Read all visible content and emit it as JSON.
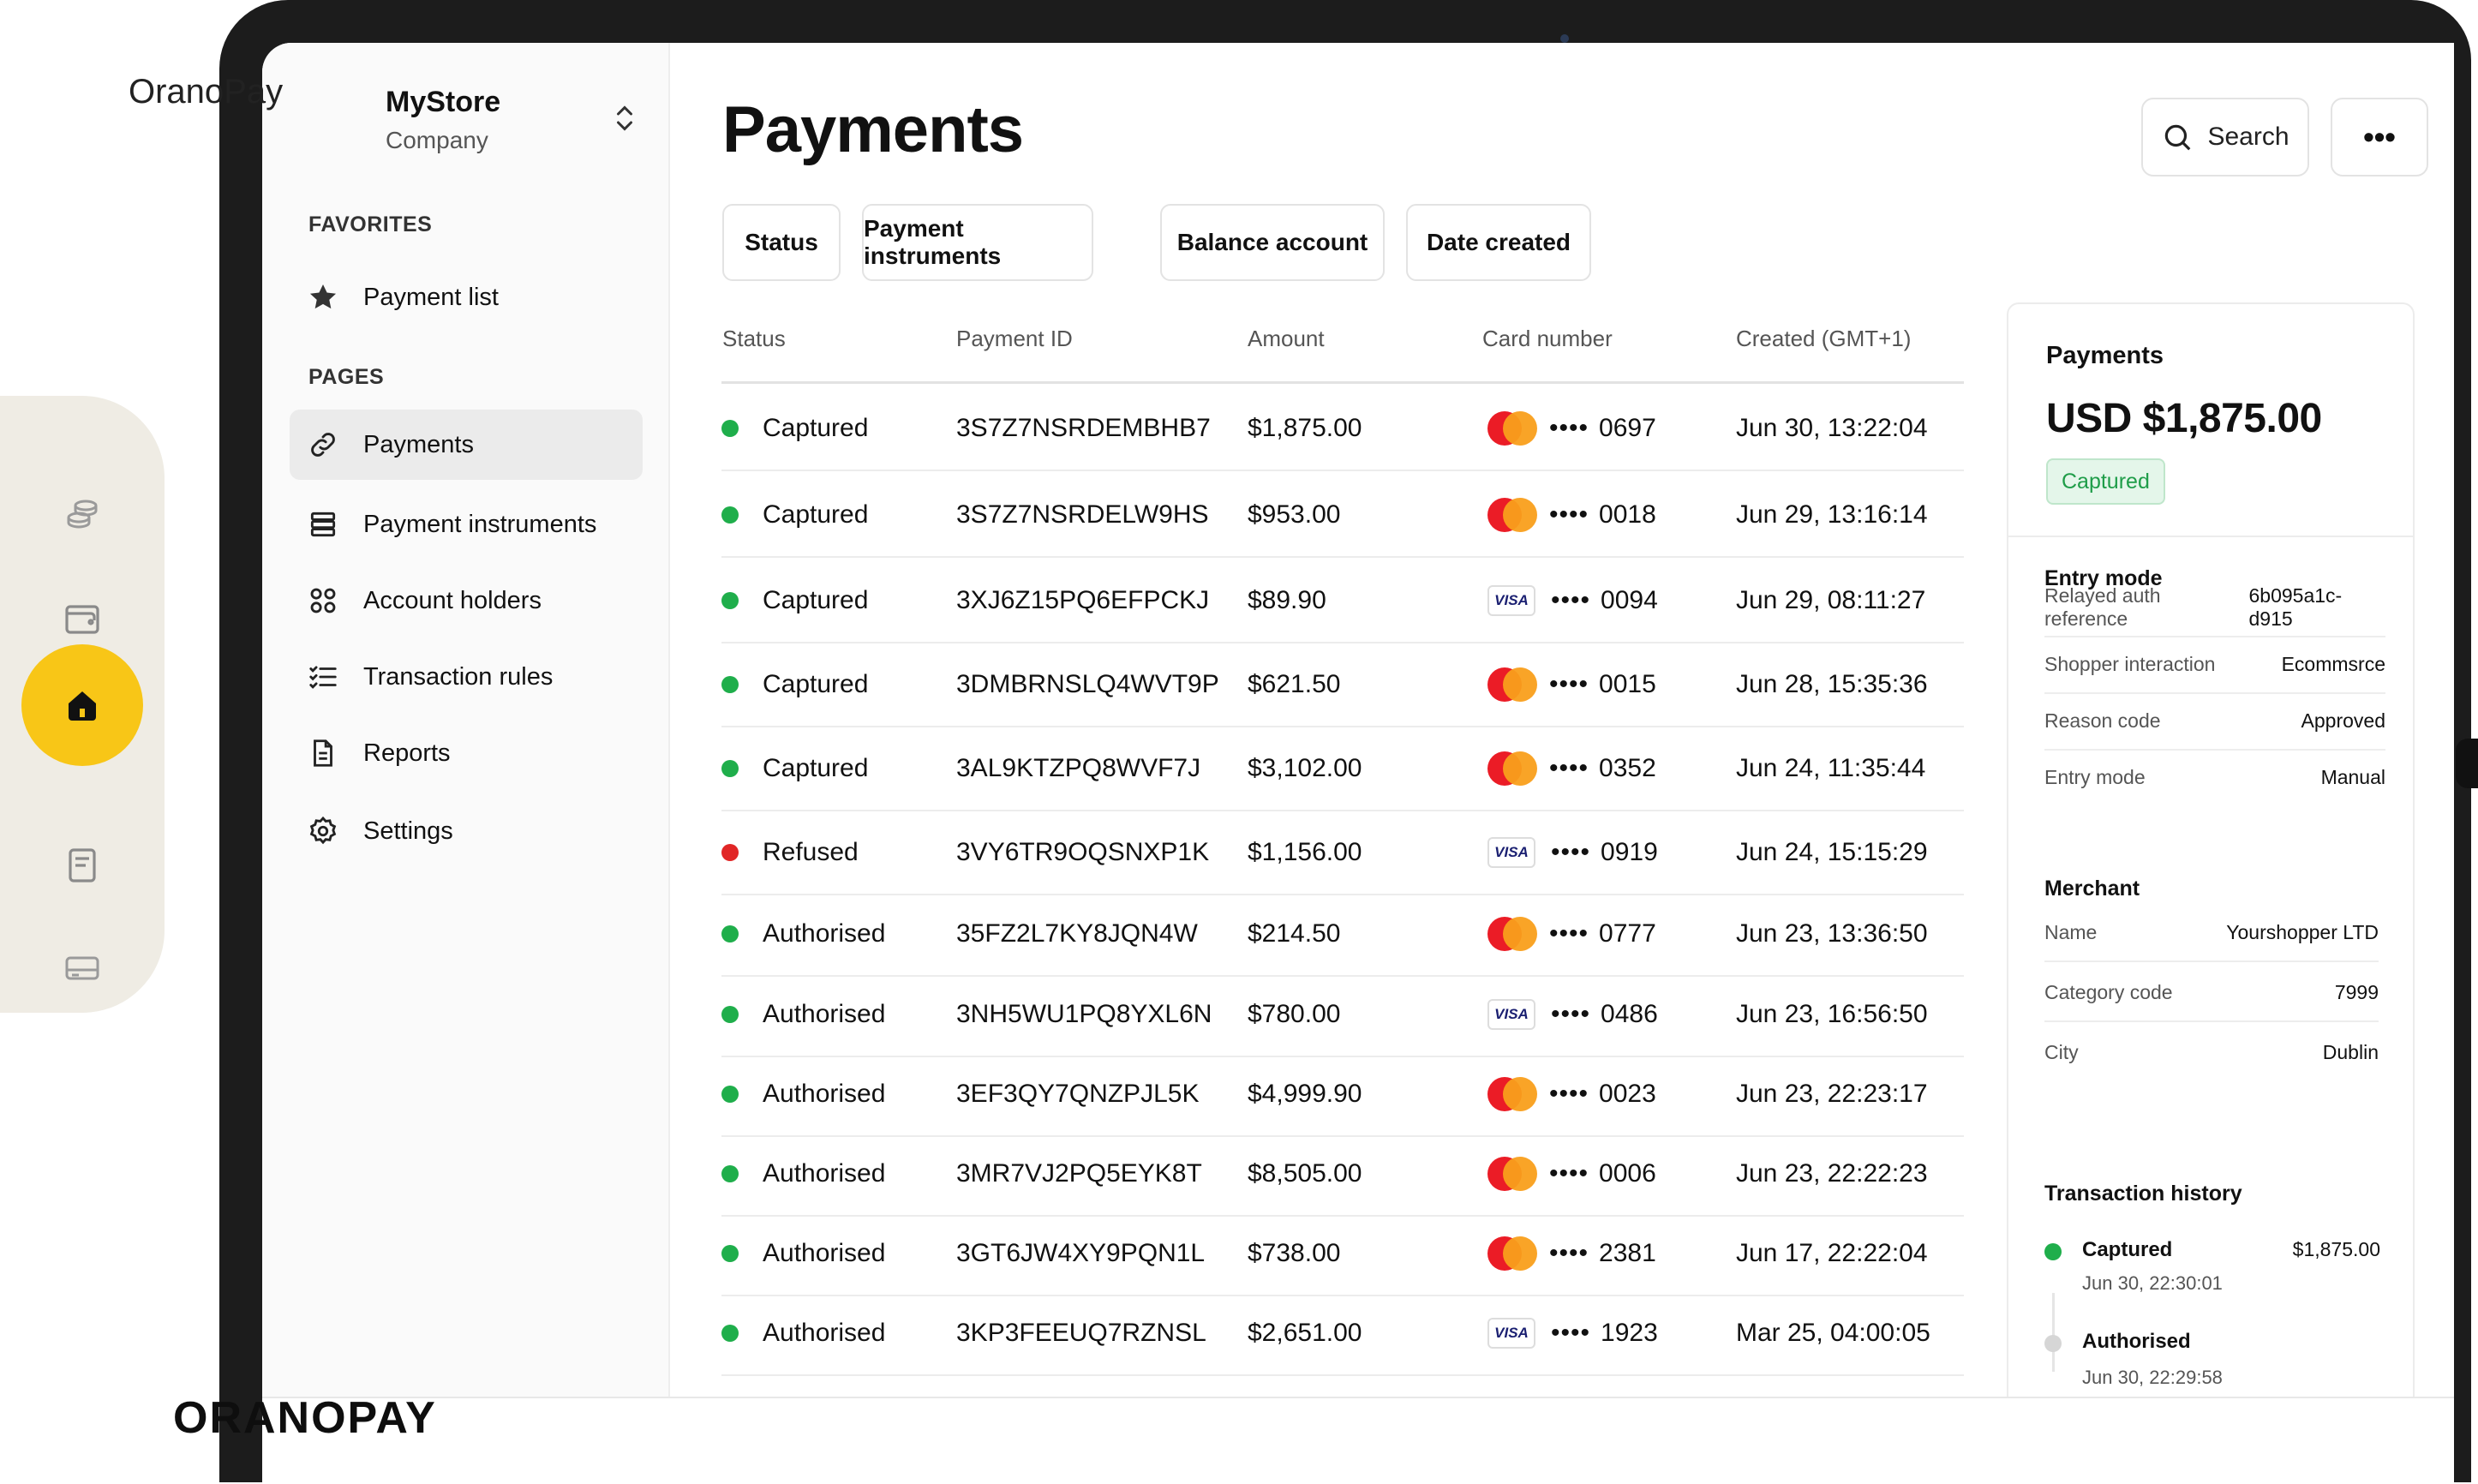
{
  "brand": {
    "top_text": "OranoPay",
    "bottom_text": "ORANOPAY"
  },
  "colors": {
    "accent": "#f8c617",
    "success": "#1fae4b",
    "danger": "#e12626"
  },
  "rail": {
    "icons": [
      "coins-icon",
      "wallet-icon",
      "home-icon",
      "document-icon",
      "card-icon"
    ],
    "active": "home-icon"
  },
  "sidebar": {
    "store_name": "MyStore",
    "store_type": "Company",
    "favorites_label": "FAVORITES",
    "favorites": [
      {
        "label": "Payment list",
        "icon": "star-icon"
      }
    ],
    "pages_label": "PAGES",
    "pages": [
      {
        "label": "Payments",
        "icon": "link-icon",
        "active": true
      },
      {
        "label": "Payment instruments",
        "icon": "stack-icon"
      },
      {
        "label": "Account holders",
        "icon": "grid-circles-icon"
      },
      {
        "label": "Transaction rules",
        "icon": "checklist-icon"
      },
      {
        "label": "Reports",
        "icon": "report-icon"
      },
      {
        "label": "Settings",
        "icon": "gear-icon"
      }
    ]
  },
  "header": {
    "title": "Payments",
    "search_label": "Search",
    "more_label": "•••"
  },
  "filters": [
    "Status",
    "Payment instruments",
    "Balance account",
    "Date created"
  ],
  "table": {
    "columns": [
      "Status",
      "Payment ID",
      "Amount",
      "Card number",
      "Created (GMT+1)"
    ],
    "rows": [
      {
        "status": "Captured",
        "status_color": "#1fae4b",
        "id": "3S7Z7NSRDEMBHB7",
        "amount": "$1,875.00",
        "brand": "mastercard",
        "mask": "••••",
        "last4": "0697",
        "created": "Jun 30, 13:22:04"
      },
      {
        "status": "Captured",
        "status_color": "#1fae4b",
        "id": "3S7Z7NSRDELW9HS",
        "amount": "$953.00",
        "brand": "mastercard",
        "mask": "••••",
        "last4": "0018",
        "created": "Jun 29, 13:16:14"
      },
      {
        "status": "Captured",
        "status_color": "#1fae4b",
        "id": "3XJ6Z15PQ6EFPCKJ",
        "amount": "$89.90",
        "brand": "visa",
        "mask": "••••",
        "last4": "0094",
        "created": "Jun 29, 08:11:27"
      },
      {
        "status": "Captured",
        "status_color": "#1fae4b",
        "id": "3DMBRNSLQ4WVT9P",
        "amount": "$621.50",
        "brand": "mastercard",
        "mask": "••••",
        "last4": "0015",
        "created": "Jun 28, 15:35:36"
      },
      {
        "status": "Captured",
        "status_color": "#1fae4b",
        "id": "3AL9KTZPQ8WVF7J",
        "amount": "$3,102.00",
        "brand": "mastercard",
        "mask": "••••",
        "last4": "0352",
        "created": "Jun 24, 11:35:44"
      },
      {
        "status": "Refused",
        "status_color": "#e12626",
        "id": "3VY6TR9OQSNXP1K",
        "amount": "$1,156.00",
        "brand": "visa",
        "mask": "••••",
        "last4": "0919",
        "created": "Jun 24, 15:15:29"
      },
      {
        "status": "Authorised",
        "status_color": "#1fae4b",
        "id": "35FZ2L7KY8JQN4W",
        "amount": "$214.50",
        "brand": "mastercard",
        "mask": "••••",
        "last4": "0777",
        "created": "Jun 23, 13:36:50"
      },
      {
        "status": "Authorised",
        "status_color": "#1fae4b",
        "id": "3NH5WU1PQ8YXL6N",
        "amount": "$780.00",
        "brand": "visa",
        "mask": "••••",
        "last4": "0486",
        "created": "Jun 23, 16:56:50"
      },
      {
        "status": "Authorised",
        "status_color": "#1fae4b",
        "id": "3EF3QY7QNZPJL5K",
        "amount": "$4,999.90",
        "brand": "mastercard",
        "mask": "••••",
        "last4": "0023",
        "created": "Jun 23, 22:23:17"
      },
      {
        "status": "Authorised",
        "status_color": "#1fae4b",
        "id": "3MR7VJ2PQ5EYK8T",
        "amount": "$8,505.00",
        "brand": "mastercard",
        "mask": "••••",
        "last4": "0006",
        "created": "Jun 23, 22:22:23"
      },
      {
        "status": "Authorised",
        "status_color": "#1fae4b",
        "id": "3GT6JW4XY9PQN1L",
        "amount": "$738.00",
        "brand": "mastercard",
        "mask": "••••",
        "last4": "2381",
        "created": "Jun 17, 22:22:04"
      },
      {
        "status": "Authorised",
        "status_color": "#1fae4b",
        "id": "3KP3FEEUQ7RZNSL",
        "amount": "$2,651.00",
        "brand": "visa",
        "mask": "••••",
        "last4": "1923",
        "created": "Mar 25, 04:00:05"
      }
    ]
  },
  "detail": {
    "title": "Payments",
    "amount": "USD $1,875.00",
    "status": "Captured",
    "entry_mode_label": "Entry mode",
    "entry_mode": [
      {
        "k": "Relayed auth reference",
        "v": "6b095a1c-d915"
      },
      {
        "k": "Shopper interaction",
        "v": "Ecommsrce"
      },
      {
        "k": "Reason code",
        "v": "Approved"
      },
      {
        "k": "Entry mode",
        "v": "Manual"
      }
    ],
    "merchant_label": "Merchant",
    "merchant": [
      {
        "k": "Name",
        "v": "Yourshopper LTD"
      },
      {
        "k": "Category code",
        "v": "7999"
      },
      {
        "k": "City",
        "v": "Dublin"
      }
    ],
    "history_label": "Transaction history",
    "history": [
      {
        "title": "Captured",
        "time": "Jun 30, 22:30:01",
        "amount": "$1,875.00",
        "color": "#1fae4b"
      },
      {
        "title": "Authorised",
        "time": "Jun 30, 22:29:58",
        "amount": "",
        "color": "#d6d6d6"
      }
    ]
  }
}
